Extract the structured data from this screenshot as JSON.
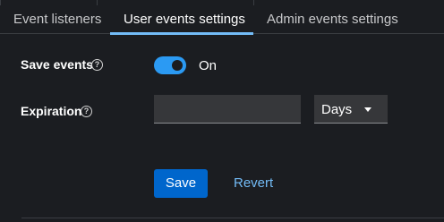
{
  "tabs": [
    {
      "label": "Event listeners",
      "active": false
    },
    {
      "label": "User events settings",
      "active": true
    },
    {
      "label": "Admin events settings",
      "active": false
    }
  ],
  "form": {
    "save_events": {
      "label": "Save events",
      "help_icon": "question-circle-icon",
      "toggle_on": true,
      "toggle_text": "On"
    },
    "expiration": {
      "label": "Expiration",
      "help_icon": "question-circle-icon",
      "value": "",
      "unit": "Days"
    }
  },
  "actions": {
    "save_label": "Save",
    "revert_label": "Revert"
  },
  "colors": {
    "background": "#1b1d21",
    "accent": "#2b9af3",
    "primary_button": "#0066cc",
    "link": "#73bcf7"
  }
}
